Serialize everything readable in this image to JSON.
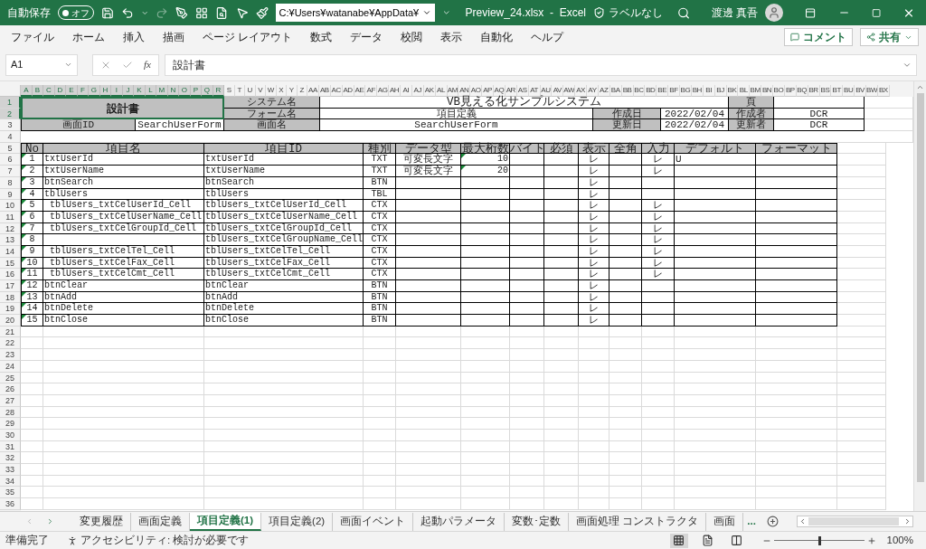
{
  "title_bar": {
    "autosave_label": "自動保存",
    "autosave_toggle": {
      "label": "オフ",
      "on": false
    },
    "path": "C:¥Users¥watanabe¥AppData¥",
    "file_title": "Preview_24.xlsx  -  Excel",
    "sensitivity": "ラベルなし",
    "user_name": "渡邊 真吾"
  },
  "ribbon_tabs": [
    "ファイル",
    "ホーム",
    "挿入",
    "描画",
    "ページ レイアウト",
    "数式",
    "データ",
    "校閲",
    "表示",
    "自動化",
    "ヘルプ"
  ],
  "ribbon_buttons": [
    {
      "kind": "comment",
      "label": "コメント"
    },
    {
      "kind": "share",
      "label": "共有"
    }
  ],
  "formula_bar": {
    "name_box": "A1",
    "function_label": "fx",
    "value": "設計書"
  },
  "column_headers": [
    {
      "label": "A",
      "selected": true
    },
    {
      "label": "B",
      "selected": true
    },
    {
      "label": "C",
      "selected": true
    },
    {
      "label": "D",
      "selected": true
    },
    {
      "label": "E",
      "selected": true
    },
    {
      "label": "F",
      "selected": true
    },
    {
      "label": "G",
      "selected": true
    },
    {
      "label": "H",
      "selected": true
    },
    {
      "label": "I",
      "selected": true
    },
    {
      "label": "J",
      "selected": true
    },
    {
      "label": "K",
      "selected": true
    },
    {
      "label": "L",
      "selected": true
    },
    {
      "label": "M",
      "selected": true
    },
    {
      "label": "N",
      "selected": true
    },
    {
      "label": "O",
      "selected": true
    },
    {
      "label": "P",
      "selected": true
    },
    {
      "label": "Q",
      "selected": true
    },
    {
      "label": "R",
      "selected": true
    },
    {
      "label": "S",
      "selected": false
    },
    {
      "label": "T",
      "selected": false
    },
    {
      "label": "U",
      "selected": false
    },
    {
      "label": "V",
      "selected": false
    },
    {
      "label": "W",
      "selected": false
    },
    {
      "label": "X",
      "selected": false
    },
    {
      "label": "Y",
      "selected": false
    },
    {
      "label": "Z",
      "selected": false
    },
    {
      "label": "AA",
      "selected": false
    },
    {
      "label": "AB",
      "selected": false
    },
    {
      "label": "AC",
      "selected": false
    },
    {
      "label": "AD",
      "selected": false
    },
    {
      "label": "AE",
      "selected": false
    },
    {
      "label": "AF",
      "selected": false
    },
    {
      "label": "AG",
      "selected": false
    },
    {
      "label": "AH",
      "selected": false
    },
    {
      "label": "AI",
      "selected": false
    },
    {
      "label": "AJ",
      "selected": false
    },
    {
      "label": "AK",
      "selected": false
    },
    {
      "label": "AL",
      "selected": false
    },
    {
      "label": "AM",
      "selected": false
    },
    {
      "label": "AN",
      "selected": false
    },
    {
      "label": "AO",
      "selected": false
    },
    {
      "label": "AP",
      "selected": false
    },
    {
      "label": "AQ",
      "selected": false
    },
    {
      "label": "AR",
      "selected": false
    },
    {
      "label": "AS",
      "selected": false
    },
    {
      "label": "AT",
      "selected": false
    },
    {
      "label": "AU",
      "selected": false
    },
    {
      "label": "AV",
      "selected": false
    },
    {
      "label": "AW",
      "selected": false
    },
    {
      "label": "AX",
      "selected": false
    },
    {
      "label": "AY",
      "selected": false
    },
    {
      "label": "AZ",
      "selected": false
    },
    {
      "label": "BA",
      "selected": false
    },
    {
      "label": "BB",
      "selected": false
    },
    {
      "label": "BC",
      "selected": false
    },
    {
      "label": "BD",
      "selected": false
    },
    {
      "label": "BE",
      "selected": false
    },
    {
      "label": "BF",
      "selected": false
    },
    {
      "label": "BG",
      "selected": false
    },
    {
      "label": "BH",
      "selected": false
    },
    {
      "label": "BI",
      "selected": false
    },
    {
      "label": "BJ",
      "selected": false
    },
    {
      "label": "BK",
      "selected": false
    },
    {
      "label": "BL",
      "selected": false
    },
    {
      "label": "BM",
      "selected": false
    },
    {
      "label": "BN",
      "selected": false
    },
    {
      "label": "BO",
      "selected": false
    },
    {
      "label": "BP",
      "selected": false
    },
    {
      "label": "BQ",
      "selected": false
    },
    {
      "label": "BR",
      "selected": false
    },
    {
      "label": "BS",
      "selected": false
    },
    {
      "label": "BT",
      "selected": false
    },
    {
      "label": "BU",
      "selected": false
    },
    {
      "label": "BV",
      "selected": false
    },
    {
      "label": "BW",
      "selected": false
    },
    {
      "label": "BX",
      "selected": false
    }
  ],
  "row_headers": [
    {
      "label": "1",
      "selected": true
    },
    {
      "label": "2",
      "selected": true
    },
    {
      "label": "3",
      "selected": false
    },
    {
      "label": "4",
      "selected": false
    },
    {
      "label": "5",
      "selected": false
    },
    {
      "label": "6",
      "selected": false
    },
    {
      "label": "7",
      "selected": false
    },
    {
      "label": "8",
      "selected": false
    },
    {
      "label": "9",
      "selected": false
    },
    {
      "label": "10",
      "selected": false
    },
    {
      "label": "11",
      "selected": false
    },
    {
      "label": "12",
      "selected": false
    },
    {
      "label": "13",
      "selected": false
    },
    {
      "label": "14",
      "selected": false
    },
    {
      "label": "15",
      "selected": false
    },
    {
      "label": "16",
      "selected": false
    },
    {
      "label": "17",
      "selected": false
    },
    {
      "label": "18",
      "selected": false
    },
    {
      "label": "19",
      "selected": false
    },
    {
      "label": "20",
      "selected": false
    },
    {
      "label": "21",
      "selected": false
    },
    {
      "label": "22",
      "selected": false
    },
    {
      "label": "23",
      "selected": false
    },
    {
      "label": "24",
      "selected": false
    },
    {
      "label": "25",
      "selected": false
    },
    {
      "label": "26",
      "selected": false
    },
    {
      "label": "27",
      "selected": false
    },
    {
      "label": "28",
      "selected": false
    },
    {
      "label": "29",
      "selected": false
    },
    {
      "label": "30",
      "selected": false
    },
    {
      "label": "31",
      "selected": false
    },
    {
      "label": "32",
      "selected": false
    },
    {
      "label": "33",
      "selected": false
    },
    {
      "label": "34",
      "selected": false
    },
    {
      "label": "35",
      "selected": false
    },
    {
      "label": "36",
      "selected": false
    }
  ],
  "sheet_header": {
    "title": "設計書",
    "system_label": "システム名",
    "system_name": "VB見える化サンプルシステム",
    "page_label": "頁",
    "form_label": "フォーム名",
    "form_name": "項目定義",
    "created_label": "作成日",
    "created_date": "2022/02/04",
    "author_label": "作成者",
    "author": "DCR",
    "screen_id_label": "画面ID",
    "screen_id": "SearchUserForm",
    "screen_name_label": "画面名",
    "screen_name": "SearchUserForm",
    "updated_label": "更新日",
    "updated_date": "2022/02/04",
    "updater_label": "更新者",
    "updater": "DCR"
  },
  "table": {
    "columns": [
      "No",
      "項目名",
      "項目ID",
      "種別",
      "データ型",
      "最大桁数",
      "バイト",
      "必須",
      "表示",
      "全角",
      "入力",
      "デフォルト",
      "フォーマット"
    ],
    "rows": [
      {
        "flag": true,
        "no": "1",
        "name": "txtUserId",
        "indented": false,
        "id": "txtUserId",
        "type": "TXT",
        "data_type": "可変長文字",
        "max_digits": "10",
        "max_flag": true,
        "display": "レ",
        "input": "レ",
        "default": "U"
      },
      {
        "flag": true,
        "no": "2",
        "name": "txtUserName",
        "indented": false,
        "id": "txtUserName",
        "type": "TXT",
        "data_type": "可変長文字",
        "max_digits": "20",
        "max_flag": true,
        "display": "レ",
        "input": "レ"
      },
      {
        "flag": true,
        "no": "3",
        "name": "btnSearch",
        "indented": false,
        "id": "btnSearch",
        "type": "BTN",
        "max_flag": false,
        "display": "レ"
      },
      {
        "flag": true,
        "no": "4",
        "name": "tblUsers",
        "indented": false,
        "id": "tblUsers",
        "type": "TBL",
        "max_flag": false,
        "display": "レ"
      },
      {
        "flag": true,
        "no": "5",
        "name": "tblUsers_txtCelUserId_Cell",
        "indented": true,
        "id": "tblUsers_txtCelUserId_Cell",
        "type": "CTX",
        "max_flag": false,
        "display": "レ",
        "input": "レ"
      },
      {
        "flag": true,
        "no": "6",
        "name": "tblUsers_txtCelUserName_Cell",
        "indented": true,
        "id": "tblUsers_txtCelUserName_Cell",
        "type": "CTX",
        "max_flag": false,
        "display": "レ",
        "input": "レ"
      },
      {
        "flag": true,
        "no": "7",
        "name": "tblUsers_txtCelGroupId_Cell",
        "indented": true,
        "id": "tblUsers_txtCelGroupId_Cell",
        "type": "CTX",
        "max_flag": false,
        "display": "レ",
        "input": "レ"
      },
      {
        "flag": true,
        "no": "8",
        "indented": false,
        "id": "tblUsers_txtCelGroupName_Cell",
        "type": "CTX",
        "max_flag": false,
        "display": "レ",
        "input": "レ"
      },
      {
        "flag": true,
        "no": "9",
        "name": "tblUsers_txtCelTel_Cell",
        "indented": true,
        "id": "tblUsers_txtCelTel_Cell",
        "type": "CTX",
        "max_flag": false,
        "display": "レ",
        "input": "レ"
      },
      {
        "flag": true,
        "no": "10",
        "name": "tblUsers_txtCelFax_Cell",
        "indented": true,
        "id": "tblUsers_txtCelFax_Cell",
        "type": "CTX",
        "max_flag": false,
        "display": "レ",
        "input": "レ"
      },
      {
        "flag": true,
        "no": "11",
        "name": "tblUsers_txtCelCmt_Cell",
        "indented": true,
        "id": "tblUsers_txtCelCmt_Cell",
        "type": "CTX",
        "max_flag": false,
        "display": "レ",
        "input": "レ"
      },
      {
        "flag": true,
        "no": "12",
        "name": "btnClear",
        "indented": false,
        "id": "btnClear",
        "type": "BTN",
        "max_flag": false,
        "display": "レ"
      },
      {
        "flag": true,
        "no": "13",
        "name": "btnAdd",
        "indented": false,
        "id": "btnAdd",
        "type": "BTN",
        "max_flag": false,
        "display": "レ"
      },
      {
        "flag": true,
        "no": "14",
        "name": "btnDelete",
        "indented": false,
        "id": "btnDelete",
        "type": "BTN",
        "max_flag": false,
        "display": "レ"
      },
      {
        "flag": true,
        "no": "15",
        "name": "btnClose",
        "indented": false,
        "id": "btnClose",
        "type": "BTN",
        "max_flag": false,
        "display": "レ"
      }
    ]
  },
  "sheet_tabs": [
    {
      "label": "変更履歴",
      "selected": false
    },
    {
      "label": "画面定義",
      "selected": false
    },
    {
      "label": "項目定義(1)",
      "selected": true
    },
    {
      "label": "項目定義(2)",
      "selected": false
    },
    {
      "label": "画面イベント",
      "selected": false
    },
    {
      "label": "起動パラメータ",
      "selected": false
    },
    {
      "label": "変数･定数",
      "selected": false
    },
    {
      "label": "画面処理 コンストラクタ",
      "selected": false
    },
    {
      "label": "画面",
      "selected": false
    }
  ],
  "sheet_tabs_more": "...",
  "status_bar": {
    "ready": "準備完了",
    "accessibility": "アクセシビリティ: 検討が必要です",
    "views": [
      {
        "kind": "normal",
        "selected": true
      },
      {
        "kind": "page_layout",
        "selected": false
      },
      {
        "kind": "page_break",
        "selected": false
      }
    ],
    "zoom": {
      "level": 0.5,
      "label": "100%"
    }
  }
}
